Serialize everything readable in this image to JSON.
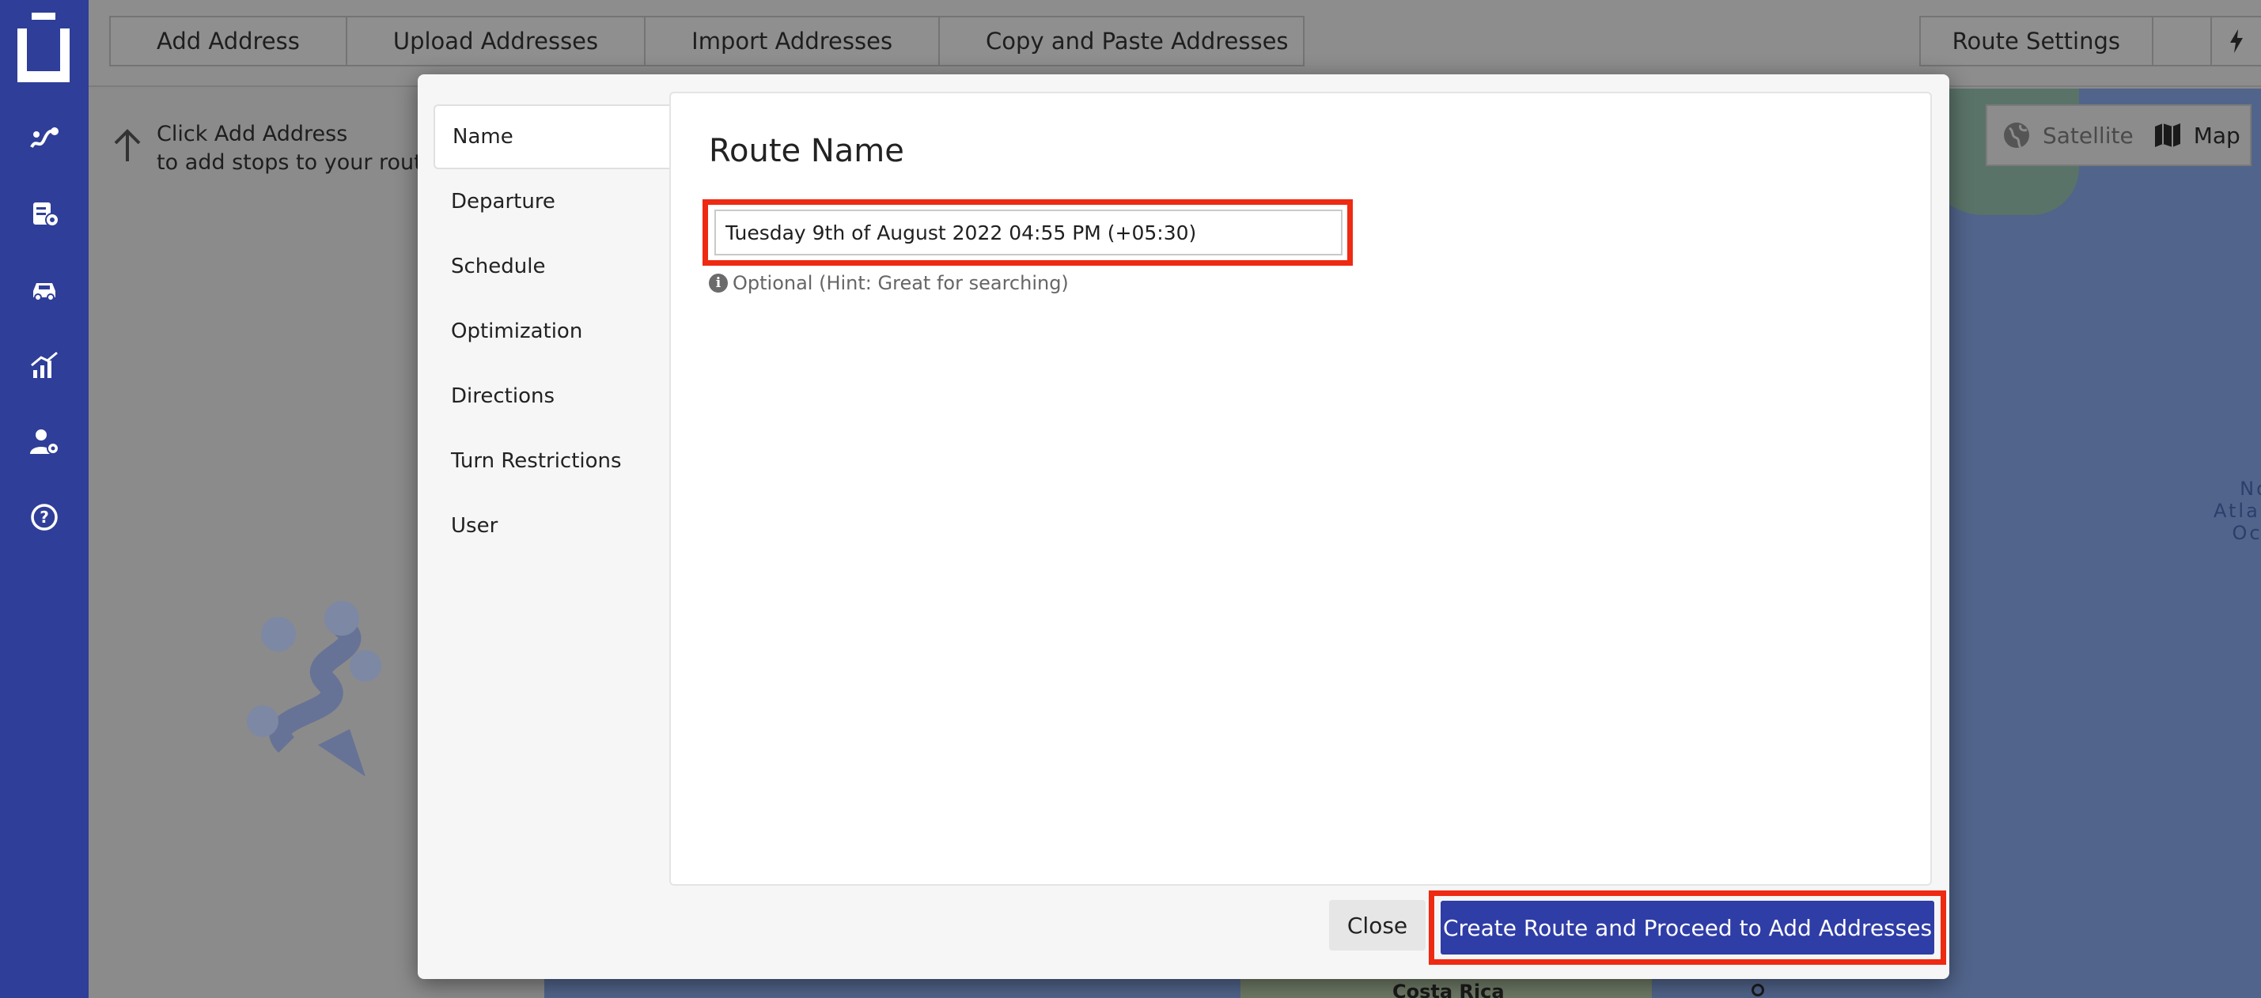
{
  "toolbar": {
    "buttons": [
      "Add Address",
      "Upload Addresses",
      "Import Addresses",
      "Copy and Paste Addresses"
    ],
    "route_settings": "Route Settings"
  },
  "left_panel": {
    "hint_line1": "Click Add Address",
    "hint_line2": "to add stops to your route."
  },
  "map": {
    "toggle_satellite": "Satellite",
    "toggle_map": "Map",
    "ocean_line1": "North",
    "ocean_line2": "Atlantic",
    "ocean_line3": "Ocean",
    "place_label": "Costa Rica"
  },
  "sidebar": {
    "icons": [
      "logo-icon",
      "routes-icon",
      "orders-icon",
      "dispatch-icon",
      "analytics-icon",
      "user-settings-icon",
      "help-icon"
    ]
  },
  "modal": {
    "tabs": [
      "Name",
      "Departure",
      "Schedule",
      "Optimization",
      "Directions",
      "Turn Restrictions",
      "User"
    ],
    "active_tab": "Name",
    "title": "Route Name",
    "route_name_value": "Tuesday 9th of August 2022 04:55 PM (+05:30)",
    "help_text": "Optional (Hint: Great for searching)",
    "close_label": "Close",
    "create_label": "Create Route and Proceed to Add Addresses"
  },
  "colors": {
    "sidebar": "#2f3e98",
    "primary_button": "#2f3da6",
    "highlight": "#ee2a12"
  }
}
